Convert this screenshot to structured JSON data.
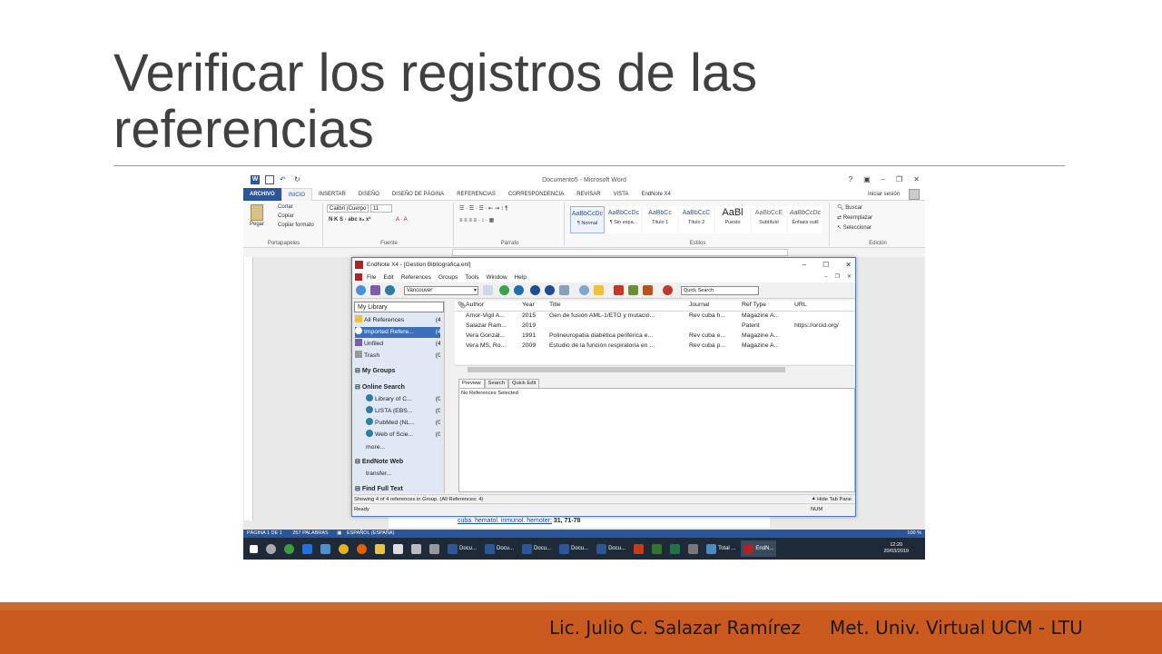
{
  "slide": {
    "title_line1": "Verificar los registros de las",
    "title_line2": "referencias",
    "footer_left": "Lic. Julio C. Salazar Ramírez",
    "footer_right": "Met. Univ. Virtual UCM - LTU"
  },
  "word": {
    "window_title": "Documento5 - Microsoft Word",
    "tabs": [
      "ARCHIVO",
      "INICIO",
      "INSERTAR",
      "DISEÑO",
      "DISEÑO DE PÁGINA",
      "REFERENCIAS",
      "CORRESPONDENCIA",
      "REVISAR",
      "VISTA",
      "EndNote X4"
    ],
    "signin": "Iniciar sesión",
    "clipboard": {
      "paste": "Pegar",
      "cut": "Cortar",
      "copy": "Copiar",
      "format": "Copiar formato",
      "label": "Portapapeles"
    },
    "font": {
      "name": "Calibri (Cuerpo",
      "size": "11",
      "label": "Fuente"
    },
    "paragraph_label": "Párrafo",
    "styles": [
      {
        "sample": "AaBbCcDc",
        "name": "¶ Normal"
      },
      {
        "sample": "AaBbCcDc",
        "name": "¶ Sin espa..."
      },
      {
        "sample": "AaBbCc",
        "name": "Título 1"
      },
      {
        "sample": "AaBbCcC",
        "name": "Título 2"
      },
      {
        "sample": "AaBl",
        "name": "Puesto"
      },
      {
        "sample": "AaBbCcE",
        "name": "Subtítulo"
      },
      {
        "sample": "AaBbCcDc",
        "name": "Énfasis sutil"
      }
    ],
    "styles_label": "Estilos",
    "editing": {
      "find": "Buscar",
      "replace": "Reemplazar",
      "select": "Seleccionar",
      "label": "Edición"
    },
    "doc_text_link": "cuba. hematol. inmunol. hemoter;",
    "doc_text_rest": " 31, 71-78",
    "status_page": "PÁGINA 1 DE 1",
    "status_words": "257 PALABRAS",
    "status_lang": "ESPAÑOL (ESPAÑA)",
    "zoom": "100 %",
    "taskbar_items": [
      "Docu...",
      "Docu...",
      "Docu...",
      "Docu...",
      "Docu...",
      "Total ...",
      "EndN..."
    ],
    "clock_time": "12:20",
    "clock_date": "20/03/2019"
  },
  "endnote": {
    "title": "EndNote X4 - [Gestion Bibliografica.enl]",
    "menu": [
      "File",
      "Edit",
      "References",
      "Groups",
      "Tools",
      "Window",
      "Help"
    ],
    "output_style": "Vancouver",
    "quick_search_placeholder": "Quick Search",
    "library_select": "My Library",
    "groups": [
      {
        "name": "All References",
        "count": "(4)"
      },
      {
        "name": "Imported Refere...",
        "count": "(4)"
      },
      {
        "name": "Unfiled",
        "count": "(4)"
      },
      {
        "name": "Trash",
        "count": "(0)"
      }
    ],
    "my_groups": "My Groups",
    "online_search": "Online Search",
    "online": [
      {
        "name": "Library of C...",
        "count": "(0)"
      },
      {
        "name": "LISTA (EBS...",
        "count": "(0)"
      },
      {
        "name": "PubMed (NL...",
        "count": "(0)"
      },
      {
        "name": "Web of Scie...",
        "count": "(0)"
      }
    ],
    "more": "more...",
    "endnote_web": "EndNote Web",
    "transfer": "transfer...",
    "find_full_text": "Find Full Text",
    "columns": {
      "author": "Author",
      "year": "Year",
      "title": "Title",
      "journal": "Journal",
      "ref_type": "Ref Type",
      "url": "URL"
    },
    "references": [
      {
        "author": "Amor-Vigil A...",
        "year": "2015",
        "title": "Gen de fusión AML-1/ETO y mutació...",
        "journal": "Rev cuba h...",
        "ref_type": "Magazine A...",
        "url": ""
      },
      {
        "author": "Salazar Ram...",
        "year": "2019",
        "title": "",
        "journal": "",
        "ref_type": "Patent",
        "url": "https://orcid.org/"
      },
      {
        "author": "Vera Gonzál...",
        "year": "1991",
        "title": "Polineuropatía diabética periférica e...",
        "journal": "Rev cuba e...",
        "ref_type": "Magazine A...",
        "url": ""
      },
      {
        "author": "Vera MS, Ro...",
        "year": "2009",
        "title": "Estudio de la función respiratoria en ...",
        "journal": "Rev cuba p...",
        "ref_type": "Magazine A...",
        "url": ""
      }
    ],
    "tabs": [
      "Preview",
      "Search",
      "Quick Edit"
    ],
    "preview_text": "No References Selected",
    "status_showing": "Showing 4 of 4 references in Group. (All References: 4)",
    "hide_tab": "Hide Tab Pane",
    "status_ready": "Ready",
    "status_num": "NUM"
  },
  "colors": {
    "word_blue": "#2b579a",
    "footer_orange": "#ca5a1e",
    "selection": "#3c6fb8"
  }
}
